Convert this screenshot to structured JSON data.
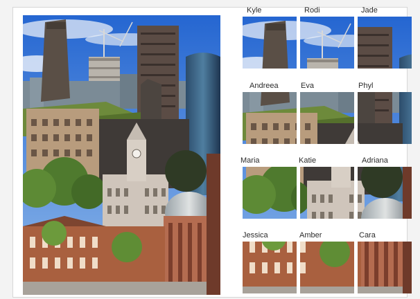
{
  "collage": {
    "names": [
      "Kyle",
      "Rodi",
      "Jade",
      "Andreea",
      "Eva",
      "Phyl",
      "Maria",
      "Katie",
      "Adriana",
      "Jessica",
      "Amber",
      "Cara"
    ]
  },
  "colors": {
    "sky": "#2e6fd6",
    "brick": "#b36a4f",
    "stone": "#cfc6bd",
    "dark_tower": "#4d4945",
    "grass": "#6e8a3a"
  }
}
